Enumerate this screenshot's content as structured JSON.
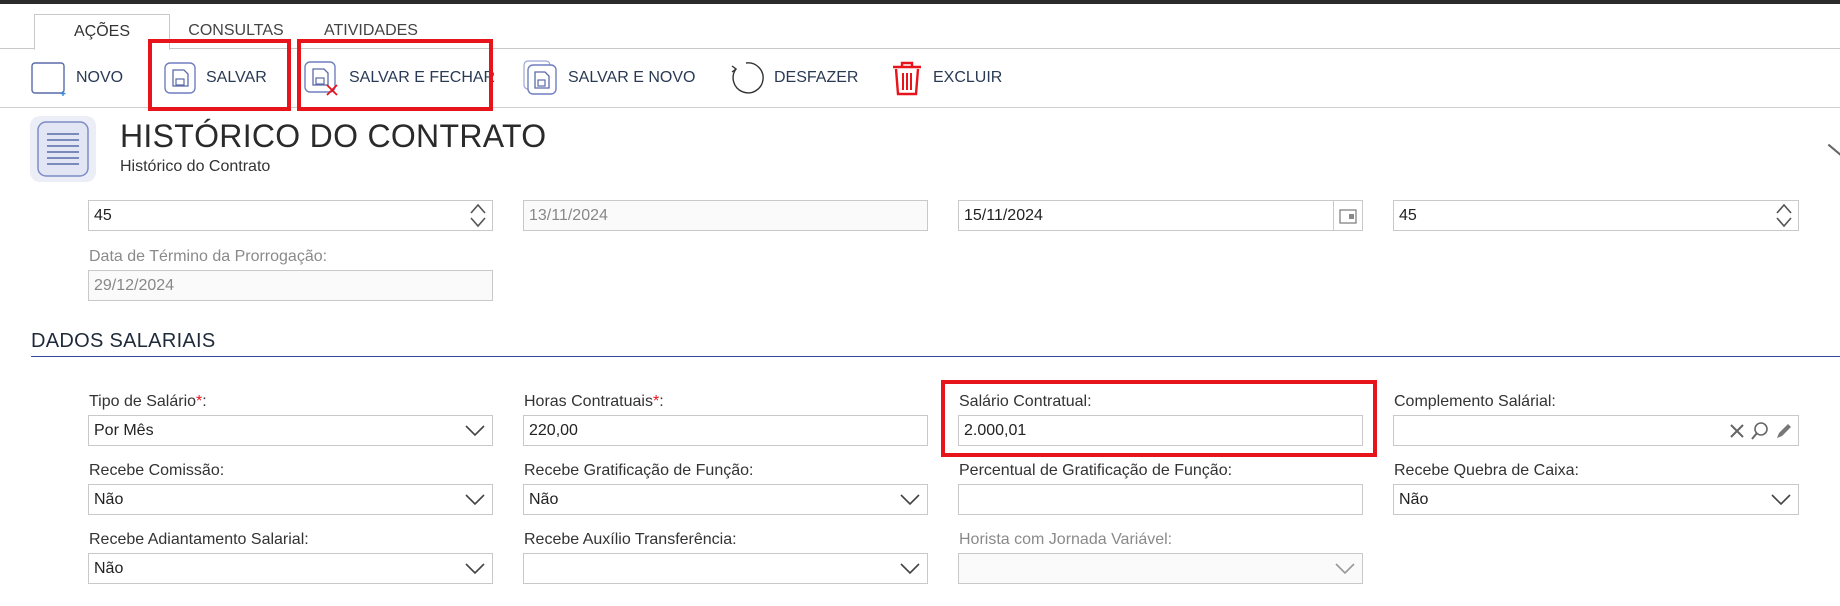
{
  "tabs": [
    {
      "label": "AÇÕES",
      "active": true
    },
    {
      "label": "CONSULTAS",
      "active": false
    },
    {
      "label": "ATIVIDADES",
      "active": false
    }
  ],
  "toolbar": {
    "novo": "NOVO",
    "salvar": "SALVAR",
    "salvar_fechar": "SALVAR E FECHAR",
    "salvar_novo": "SALVAR E NOVO",
    "desfazer": "DESFAZER",
    "excluir": "EXCLUIR"
  },
  "header": {
    "title": "HISTÓRICO DO CONTRATO",
    "subtitle": "Histórico do Contrato"
  },
  "prorrogacao": {
    "dias1": "45",
    "data_inicio": "13/11/2024",
    "data_fim": "15/11/2024",
    "dias2": "45",
    "termino_label": "Data de Término da Prorrogação:",
    "termino_value": "29/12/2024"
  },
  "section_title": "DADOS SALARIAIS",
  "salario": {
    "tipo_label": "Tipo de Salário",
    "tipo_value": "Por Mês",
    "horas_label": "Horas Contratuais",
    "horas_value": "220,00",
    "contratual_label": "Salário Contratual:",
    "contratual_value": "2.000,01",
    "complemento_label": "Complemento Salárial:",
    "complemento_value": "",
    "comissao_label": "Recebe Comissão:",
    "comissao_value": "Não",
    "gratificacao_label": "Recebe Gratificação de Função:",
    "gratificacao_value": "Não",
    "percentual_label": "Percentual de Gratificação de Função:",
    "percentual_value": "",
    "quebra_label": "Recebe Quebra de Caixa:",
    "quebra_value": "Não",
    "adiantamento_label": "Recebe Adiantamento Salarial:",
    "adiantamento_value": "Não",
    "auxilio_label": "Recebe Auxílio Transferência:",
    "auxilio_value": "",
    "horista_label": "Horista com Jornada Variável:",
    "horista_value": ""
  },
  "colors": {
    "highlight": "#e8141c",
    "section_line": "#3a4a9a",
    "accent": "#2a3a55"
  }
}
